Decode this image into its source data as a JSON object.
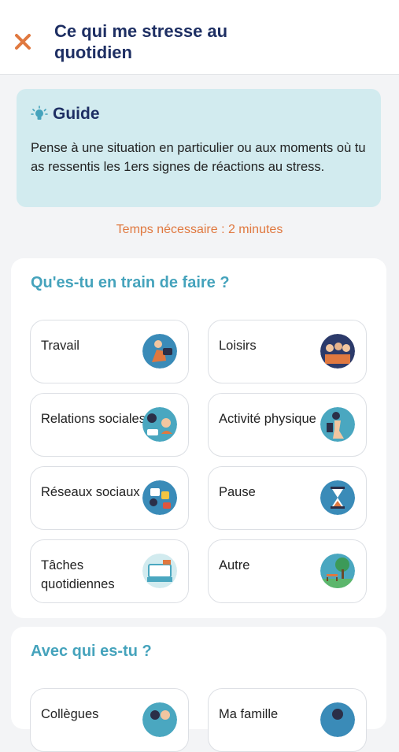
{
  "header": {
    "title": "Ce qui me stresse au quotidien"
  },
  "guide": {
    "title": "Guide",
    "text": "Pense à une situation en particulier ou aux moments où tu as ressentis les 1ers signes de réactions au stress."
  },
  "time_needed": "Temps nécessaire : 2 minutes",
  "activity": {
    "title": "Qu'es-tu en train de faire ?",
    "options": [
      {
        "label": "Travail",
        "icon": "work-icon"
      },
      {
        "label": "Loisirs",
        "icon": "leisure-icon"
      },
      {
        "label": "Relations sociales",
        "icon": "social-relations-icon"
      },
      {
        "label": "Activité physique",
        "icon": "physical-activity-icon"
      },
      {
        "label": "Réseaux sociaux",
        "icon": "social-networks-icon"
      },
      {
        "label": "Pause",
        "icon": "hourglass-icon"
      },
      {
        "label": "Tâches quotidiennes",
        "icon": "daily-tasks-icon"
      },
      {
        "label": "Autre",
        "icon": "park-bench-icon"
      }
    ]
  },
  "company": {
    "title": "Avec qui es-tu ?",
    "options": [
      {
        "label": "Collègues",
        "icon": "colleagues-icon"
      },
      {
        "label": "Ma famille",
        "icon": "family-icon"
      }
    ]
  },
  "colors": {
    "title": "#1e2f63",
    "accent": "#45a3bc",
    "orange": "#e0783f",
    "guide_bg": "#d2ebef"
  }
}
